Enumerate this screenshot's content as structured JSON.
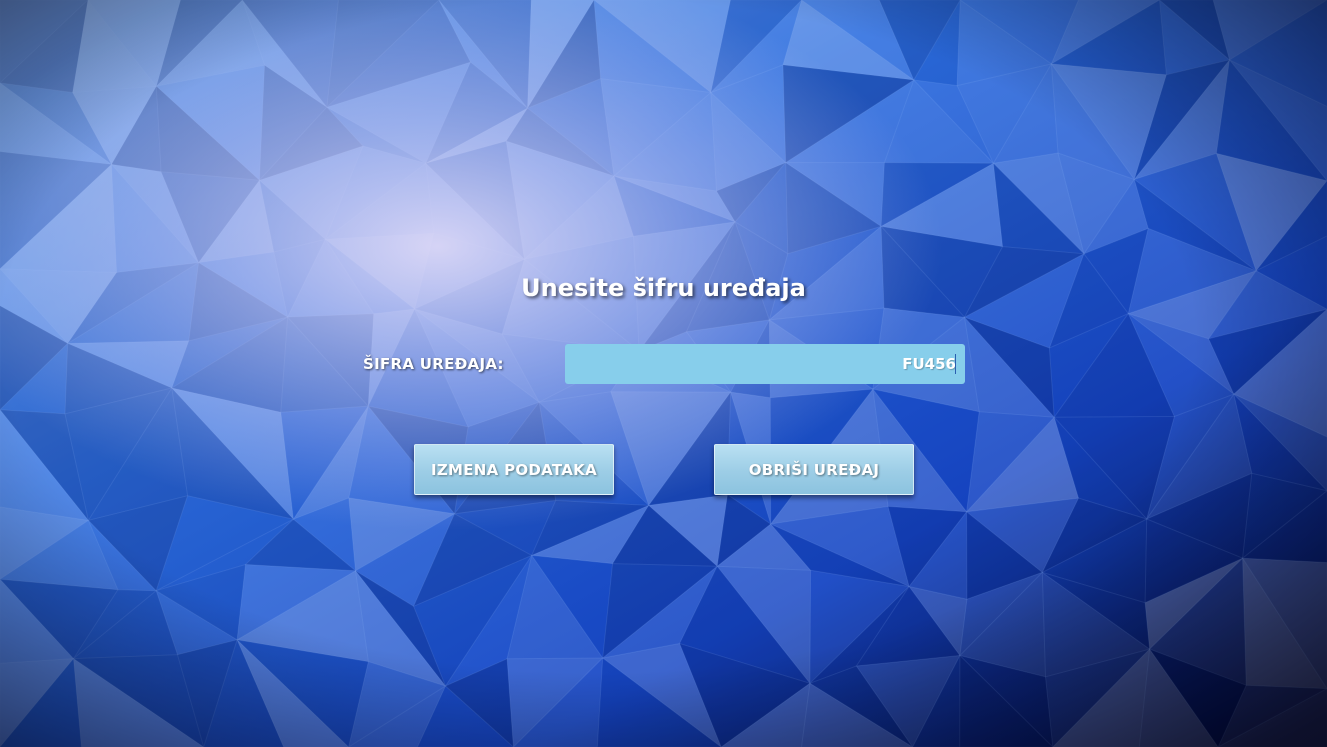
{
  "heading": "Unesite šifru uređaja",
  "device_code": {
    "label": "ŠIFRA UREĐAJA:",
    "value": "FU456"
  },
  "buttons": {
    "edit_label": "IZMENA PODATAKA",
    "delete_label": "OBRIŠI UREĐAJ"
  },
  "colors": {
    "input_background": "#87ceeb",
    "button_background": "#9ccde6",
    "text": "#ffffff"
  }
}
